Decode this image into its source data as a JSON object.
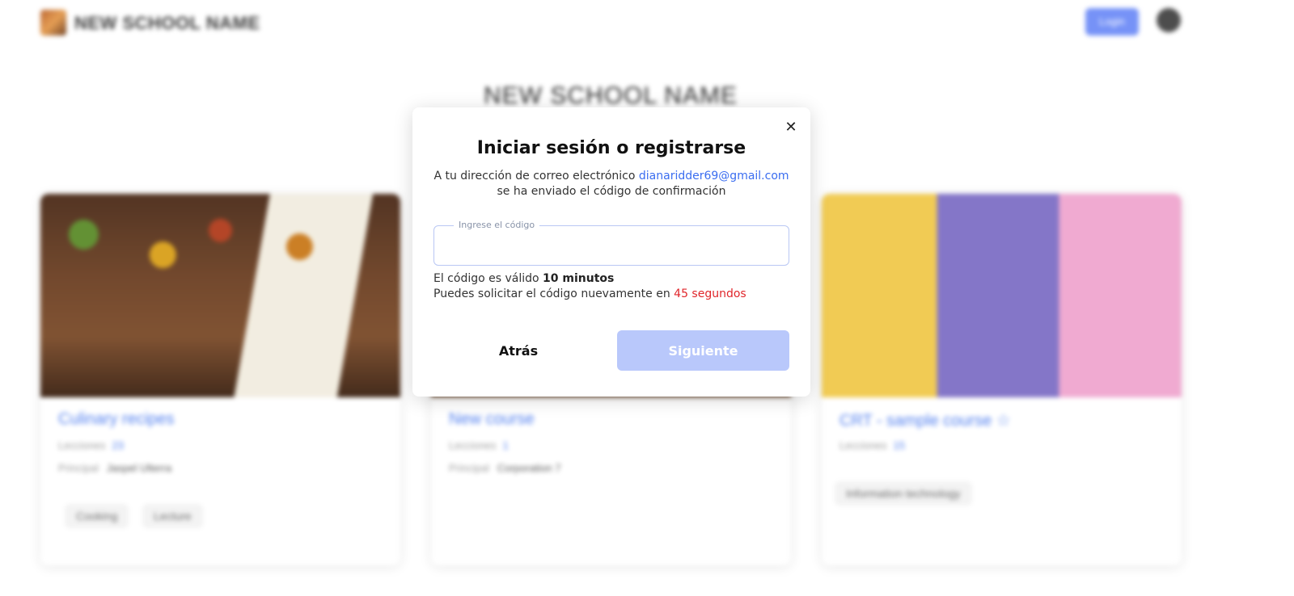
{
  "header": {
    "school_name": "NEW SCHOOL NAME",
    "login_button": "Login",
    "language_icon": "globe-icon"
  },
  "main": {
    "page_title": "NEW SCHOOL NAME",
    "courses": [
      {
        "title": "Culinary recipes",
        "lessons_label": "Lecciones",
        "lessons_count": "23",
        "author_label": "Principal",
        "author": "Jaspel Ulterra",
        "tags": [
          "Cooking",
          "Lecture"
        ]
      },
      {
        "title": "New course",
        "lessons_label": "Lecciones",
        "lessons_count": "1",
        "author_label": "Principal",
        "author": "Corporation 7"
      },
      {
        "title": "CRT - sample course ☆",
        "lessons_label": "Lecciones",
        "lessons_count": "15",
        "tags": [
          "Information technology"
        ]
      }
    ]
  },
  "modal": {
    "close_icon": "close-icon",
    "title": "Iniciar sesión o registrarse",
    "desc_before": "A tu dirección de correo electrónico ",
    "email": "dianaridder69@gmail.com",
    "desc_after": " se ha enviado el código de confirmación",
    "code_label": "Ingrese el código",
    "code_value": "",
    "valid_prefix": "El código es válido ",
    "valid_duration": "10 minutos",
    "resend_prefix": "Puedes solicitar el código nuevamente en ",
    "resend_countdown": "45 segundos",
    "back_label": "Atrás",
    "next_label": "Siguiente",
    "colors": {
      "accent": "#3a6df0",
      "countdown": "#e0262b",
      "next_disabled": "#b9c8fb"
    }
  }
}
